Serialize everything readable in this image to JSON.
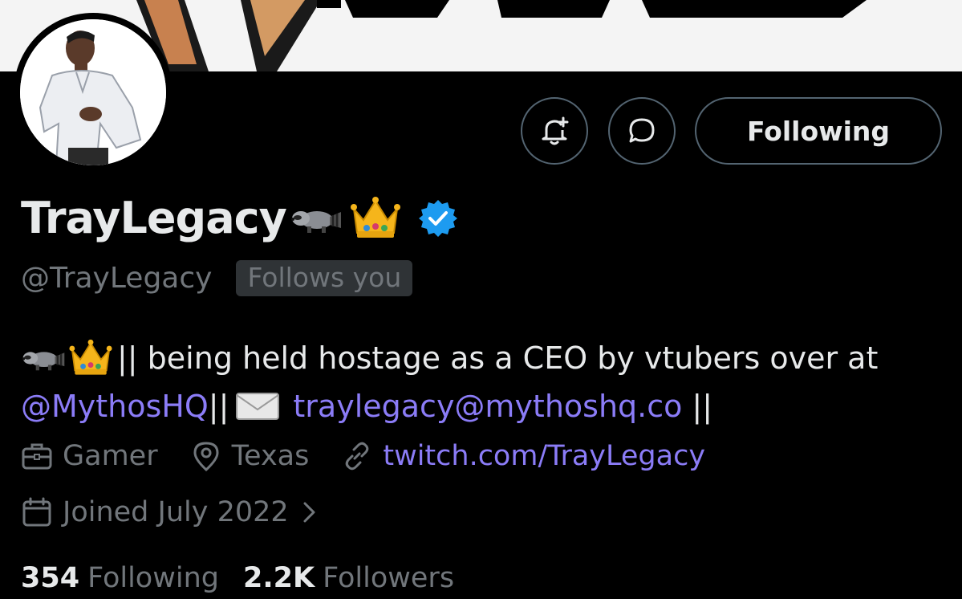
{
  "profile": {
    "display_name": "TrayLegacy",
    "handle": "@TrayLegacy",
    "follows_you_label": "Follows you",
    "verified": true
  },
  "actions": {
    "follow_label": "Following",
    "notify_icon": "bell-plus-icon",
    "message_icon": "chat-bubble-icon"
  },
  "bio": {
    "line1_text": "|| being held hostage as a CEO by vtubers over at",
    "mention": "@MythosHQ",
    "separator": "||",
    "email": "traylegacy@mythoshq.co",
    "end": "||"
  },
  "meta": {
    "category": "Gamer",
    "location": "Texas",
    "website": "twitch.com/TrayLegacy",
    "joined": "Joined July 2022"
  },
  "stats": {
    "following_count": "354",
    "following_label": "Following",
    "followers_count": "2.2K",
    "followers_label": "Followers"
  },
  "colors": {
    "link": "#8b7cf7",
    "muted": "#71767b",
    "verified": "#1d9bf0",
    "background": "#000000"
  }
}
